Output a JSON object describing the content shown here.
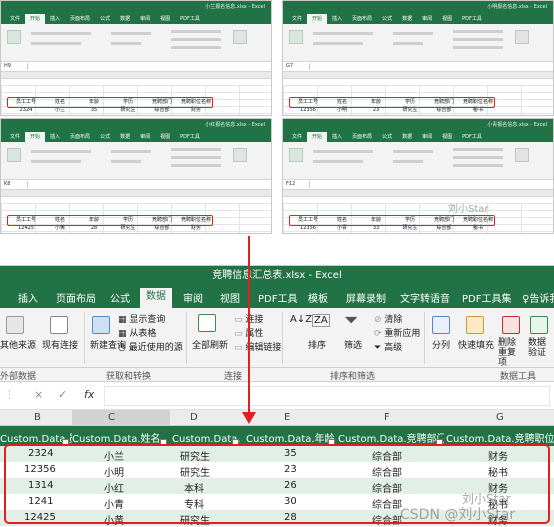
{
  "files": [
    {
      "title": "小兰报名信息.xlsx - Excel",
      "name_box": "H9",
      "menu": [
        "文件",
        "开始",
        "插入",
        "页面布局",
        "公式",
        "数据",
        "审阅",
        "视图",
        "PDF工具",
        "模板",
        "屏幕录制"
      ],
      "headers": [
        "员工工号",
        "姓名",
        "年龄",
        "学历",
        "竞聘部门",
        "竞聘职位名称"
      ],
      "row": [
        "2324",
        "小兰",
        "35",
        "研究生",
        "综合部",
        "财务"
      ]
    },
    {
      "title": "小明报名信息.xlsx - Excel",
      "name_box": "G7",
      "menu": [
        "文件",
        "开始",
        "插入",
        "页面布局",
        "公式",
        "数据",
        "审阅",
        "视图",
        "PDF工具",
        "模板",
        "屏幕录制"
      ],
      "headers": [
        "员工工号",
        "姓名",
        "年龄",
        "学历",
        "竞聘部门",
        "竞聘职位名称"
      ],
      "row": [
        "12356",
        "小明",
        "23",
        "研究生",
        "综合部",
        "秘书"
      ]
    },
    {
      "title": "小红报名信息.xlsx - Excel",
      "name_box": "K8",
      "menu": [
        "文件",
        "开始",
        "插入",
        "页面布局",
        "公式",
        "数据",
        "审阅",
        "视图",
        "PDF工具",
        "模板",
        "屏幕录制"
      ],
      "headers": [
        "员工工号",
        "姓名",
        "年龄",
        "学历",
        "竞聘部门",
        "竞聘职位名称"
      ],
      "row": [
        "12425",
        "小黄",
        "28",
        "研究生",
        "综合部",
        "财务"
      ]
    },
    {
      "title": "小青报名信息.xlsx - Excel",
      "name_box": "F12",
      "menu": [
        "文件",
        "开始",
        "插入",
        "页面布局",
        "公式",
        "数据",
        "审阅",
        "视图",
        "PDF工具",
        "模板",
        "屏幕录制"
      ],
      "headers": [
        "员工工号",
        "姓名",
        "年龄",
        "学历",
        "竞聘部门",
        "竞聘职位名称"
      ],
      "row": [
        "12356",
        "小青",
        "33",
        "研究生",
        "综合部",
        "秘书"
      ]
    }
  ],
  "main": {
    "title": "竞聘信息汇总表.xlsx - Excel",
    "menu": [
      "插入",
      "页面布局",
      "公式",
      "数据",
      "审阅",
      "视图",
      "PDF工具",
      "模板",
      "屏幕录制",
      "文字转语音",
      "PDF工具集",
      "告诉我"
    ],
    "ribbon": {
      "other_sources": "其他来源",
      "existing": "现有连接",
      "new_query": "新建查询",
      "show_queries": "显示查询",
      "from_table": "从表格",
      "recent_sources": "最近使用的源",
      "refresh_all": "全部刷新",
      "connections": "连接",
      "properties": "属性",
      "edit_links": "编辑链接",
      "sort": "排序",
      "filter": "筛选",
      "clear": "清除",
      "reapply": "重新应用",
      "advanced": "高级",
      "split": "分列",
      "flash_fill": "快速填充",
      "remove_dup": "删除重复项",
      "validate": "数据验证"
    },
    "groups": {
      "ext": "外部数据",
      "get": "获取和转换",
      "conn": "连接",
      "sortfilter": "排序和筛选",
      "tools": "数据工具"
    },
    "fx": {
      "cancel": "×",
      "enter": "✓",
      "fx": "fx"
    },
    "col_letters": [
      "B",
      "C",
      "D",
      "E",
      "F",
      "G"
    ],
    "headers": [
      "Custom.Data.员工工号",
      "Custom.Data.姓名",
      "Custom.Data.学历",
      "Custom.Data.年龄",
      "Custom.Data.竞聘部门",
      "Custom.Data.竞聘职位名称"
    ],
    "rows": [
      [
        "2324",
        "小兰",
        "研究生",
        "35",
        "综合部",
        "财务"
      ],
      [
        "12356",
        "小明",
        "研究生",
        "23",
        "综合部",
        "秘书"
      ],
      [
        "1314",
        "小红",
        "本科",
        "26",
        "综合部",
        "财务"
      ],
      [
        "1241",
        "小青",
        "专科",
        "30",
        "综合部",
        "秘书"
      ],
      [
        "12425",
        "小黄",
        "研究生",
        "28",
        "综合部",
        "财务"
      ]
    ]
  },
  "watermarks": {
    "small": "刘小Star",
    "big": "CSDN @刘小Star"
  }
}
